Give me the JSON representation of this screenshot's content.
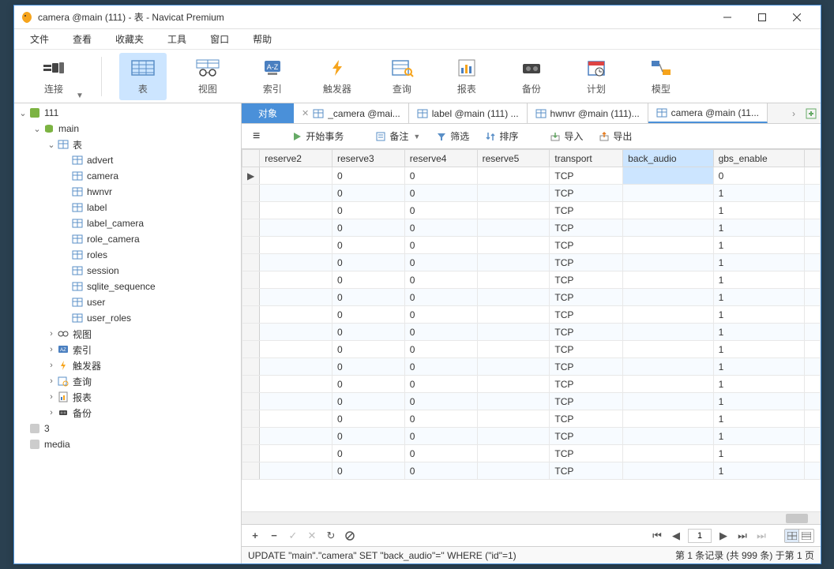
{
  "window": {
    "title": "camera @main (111) - 表 - Navicat Premium"
  },
  "menu": [
    "文件",
    "查看",
    "收藏夹",
    "工具",
    "窗口",
    "帮助"
  ],
  "toolbar": [
    {
      "id": "connection",
      "label": "连接",
      "active": false,
      "dropdown": true
    },
    {
      "id": "table",
      "label": "表",
      "active": true
    },
    {
      "id": "view",
      "label": "视图",
      "active": false
    },
    {
      "id": "index",
      "label": "索引",
      "active": false
    },
    {
      "id": "trigger",
      "label": "触发器",
      "active": false
    },
    {
      "id": "query",
      "label": "查询",
      "active": false
    },
    {
      "id": "report",
      "label": "报表",
      "active": false
    },
    {
      "id": "backup",
      "label": "备份",
      "active": false
    },
    {
      "id": "schedule",
      "label": "计划",
      "active": false
    },
    {
      "id": "model",
      "label": "模型",
      "active": false
    }
  ],
  "tree": {
    "conn": "111",
    "db": "main",
    "table_group": "表",
    "tables": [
      "advert",
      "camera",
      "hwnvr",
      "label",
      "label_camera",
      "role_camera",
      "roles",
      "session",
      "sqlite_sequence",
      "user",
      "user_roles"
    ],
    "other_groups": [
      {
        "name": "视图",
        "icon": "oo"
      },
      {
        "name": "索引",
        "icon": "az"
      },
      {
        "name": "触发器",
        "icon": "bolt"
      },
      {
        "name": "查询",
        "icon": "query"
      },
      {
        "name": "报表",
        "icon": "report"
      },
      {
        "name": "备份",
        "icon": "backup"
      }
    ],
    "siblings": [
      "3",
      "media"
    ]
  },
  "tabs": {
    "objects": "对象",
    "open": [
      {
        "label": "_camera @mai...",
        "active": false
      },
      {
        "label": "label @main (111) ...",
        "active": false
      },
      {
        "label": "hwnvr @main (111)...",
        "active": false
      },
      {
        "label": "camera @main (11...",
        "active": true
      }
    ]
  },
  "table_toolbar": {
    "menu_btn": "≡",
    "begin_tx": "开始事务",
    "memo": "备注",
    "filter": "筛选",
    "sort": "排序",
    "import": "导入",
    "export": "导出"
  },
  "columns": [
    "reserve2",
    "reserve3",
    "reserve4",
    "reserve5",
    "transport",
    "back_audio",
    "gbs_enable"
  ],
  "selected_col": 5,
  "rows": [
    {
      "mark": "▶",
      "reserve2": "",
      "reserve3": "0",
      "reserve4": "0",
      "reserve5": "",
      "transport": "TCP",
      "back_audio": "",
      "gbs_enable": "0",
      "sel": true
    },
    {
      "reserve3": "0",
      "reserve4": "0",
      "transport": "TCP",
      "gbs_enable": "1"
    },
    {
      "reserve3": "0",
      "reserve4": "0",
      "transport": "TCP",
      "gbs_enable": "1"
    },
    {
      "reserve3": "0",
      "reserve4": "0",
      "transport": "TCP",
      "gbs_enable": "1"
    },
    {
      "reserve3": "0",
      "reserve4": "0",
      "transport": "TCP",
      "gbs_enable": "1"
    },
    {
      "reserve3": "0",
      "reserve4": "0",
      "transport": "TCP",
      "gbs_enable": "1"
    },
    {
      "reserve3": "0",
      "reserve4": "0",
      "transport": "TCP",
      "gbs_enable": "1"
    },
    {
      "reserve3": "0",
      "reserve4": "0",
      "transport": "TCP",
      "gbs_enable": "1"
    },
    {
      "reserve3": "0",
      "reserve4": "0",
      "transport": "TCP",
      "gbs_enable": "1"
    },
    {
      "reserve3": "0",
      "reserve4": "0",
      "transport": "TCP",
      "gbs_enable": "1"
    },
    {
      "reserve3": "0",
      "reserve4": "0",
      "transport": "TCP",
      "gbs_enable": "1"
    },
    {
      "reserve3": "0",
      "reserve4": "0",
      "transport": "TCP",
      "gbs_enable": "1"
    },
    {
      "reserve3": "0",
      "reserve4": "0",
      "transport": "TCP",
      "gbs_enable": "1"
    },
    {
      "reserve3": "0",
      "reserve4": "0",
      "transport": "TCP",
      "gbs_enable": "1"
    },
    {
      "reserve3": "0",
      "reserve4": "0",
      "transport": "TCP",
      "gbs_enable": "1"
    },
    {
      "reserve3": "0",
      "reserve4": "0",
      "transport": "TCP",
      "gbs_enable": "1"
    },
    {
      "reserve3": "0",
      "reserve4": "0",
      "transport": "TCP",
      "gbs_enable": "1"
    },
    {
      "reserve3": "0",
      "reserve4": "0",
      "transport": "TCP",
      "gbs_enable": "1"
    }
  ],
  "nav": {
    "page": "1"
  },
  "status": {
    "sql": "UPDATE \"main\".\"camera\" SET \"back_audio\"='' WHERE (\"id\"=1)",
    "info": "第 1 条记录 (共 999 条) 于第 1 页"
  }
}
